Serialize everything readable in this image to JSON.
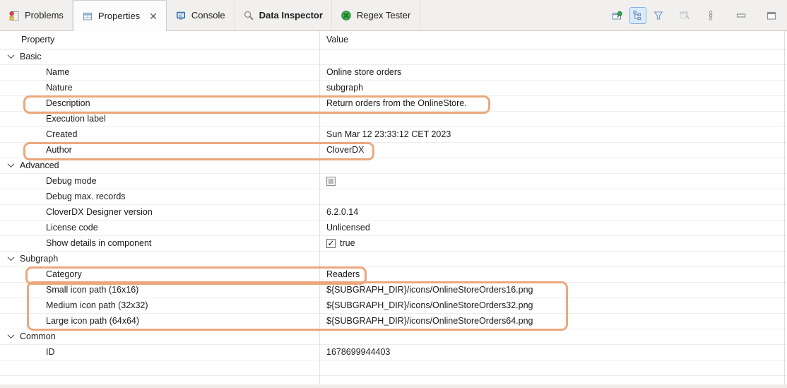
{
  "tabs": [
    {
      "label": "Problems",
      "active": false,
      "emphasized": false,
      "closable": false
    },
    {
      "label": "Properties",
      "active": true,
      "emphasized": false,
      "closable": true,
      "close_glyph": "✕"
    },
    {
      "label": "Console",
      "active": false,
      "emphasized": false,
      "closable": false
    },
    {
      "label": "Data Inspector",
      "active": false,
      "emphasized": true,
      "closable": false
    },
    {
      "label": "Regex Tester",
      "active": false,
      "emphasized": false,
      "closable": false
    }
  ],
  "toolbar": {
    "buttons": [
      {
        "name": "pin-editor",
        "state": "normal"
      },
      {
        "name": "show-categories",
        "state": "toggled"
      },
      {
        "name": "filter",
        "state": "normal"
      },
      {
        "name": "restore-default",
        "state": "disabled"
      },
      {
        "name": "view-menu",
        "state": "normal"
      },
      {
        "name": "minimize",
        "state": "normal"
      },
      {
        "name": "maximize",
        "state": "normal"
      }
    ]
  },
  "table": {
    "columns": [
      "Property",
      "Value"
    ],
    "rows": [
      {
        "type": "section",
        "label": "Basic"
      },
      {
        "type": "property",
        "label": "Name",
        "value": "Online store orders"
      },
      {
        "type": "property",
        "label": "Nature",
        "value": "subgraph"
      },
      {
        "type": "property",
        "label": "Description",
        "value": "Return orders from the OnlineStore.",
        "highlighted": true
      },
      {
        "type": "property",
        "label": "Execution label",
        "value": ""
      },
      {
        "type": "property",
        "label": "Created",
        "value": "Sun Mar 12 23:33:12 CET 2023"
      },
      {
        "type": "property",
        "label": "Author",
        "value": "CloverDX",
        "highlighted": true
      },
      {
        "type": "section",
        "label": "Advanced"
      },
      {
        "type": "property",
        "label": "Debug mode",
        "value": "",
        "checkbox": "disabled-unchecked"
      },
      {
        "type": "property",
        "label": "Debug max. records",
        "value": ""
      },
      {
        "type": "property",
        "label": "CloverDX Designer version",
        "value": "6.2.0.14"
      },
      {
        "type": "property",
        "label": "License code",
        "value": "Unlicensed"
      },
      {
        "type": "property",
        "label": "Show details in component",
        "value": "true",
        "checkbox": "checked"
      },
      {
        "type": "section",
        "label": "Subgraph"
      },
      {
        "type": "property",
        "label": "Category",
        "value": "Readers",
        "highlighted": true
      },
      {
        "type": "property",
        "label": "Small icon path (16x16)",
        "value": "${SUBGRAPH_DIR}/icons/OnlineStoreOrders16.png",
        "highlighted": true
      },
      {
        "type": "property",
        "label": "Medium icon path (32x32)",
        "value": "${SUBGRAPH_DIR}/icons/OnlineStoreOrders32.png",
        "highlighted": true
      },
      {
        "type": "property",
        "label": "Large icon path (64x64)",
        "value": "${SUBGRAPH_DIR}/icons/OnlineStoreOrders64.png",
        "highlighted": true
      },
      {
        "type": "section",
        "label": "Common"
      },
      {
        "type": "property",
        "label": "ID",
        "value": "1678699944403"
      },
      {
        "type": "empty"
      },
      {
        "type": "empty"
      }
    ]
  },
  "annotations": {
    "highlight_color": "#eba87d",
    "highlights": [
      "Description row",
      "Author row",
      "Category row",
      "Icon path rows (16x16, 32x32, 64x64)"
    ]
  }
}
